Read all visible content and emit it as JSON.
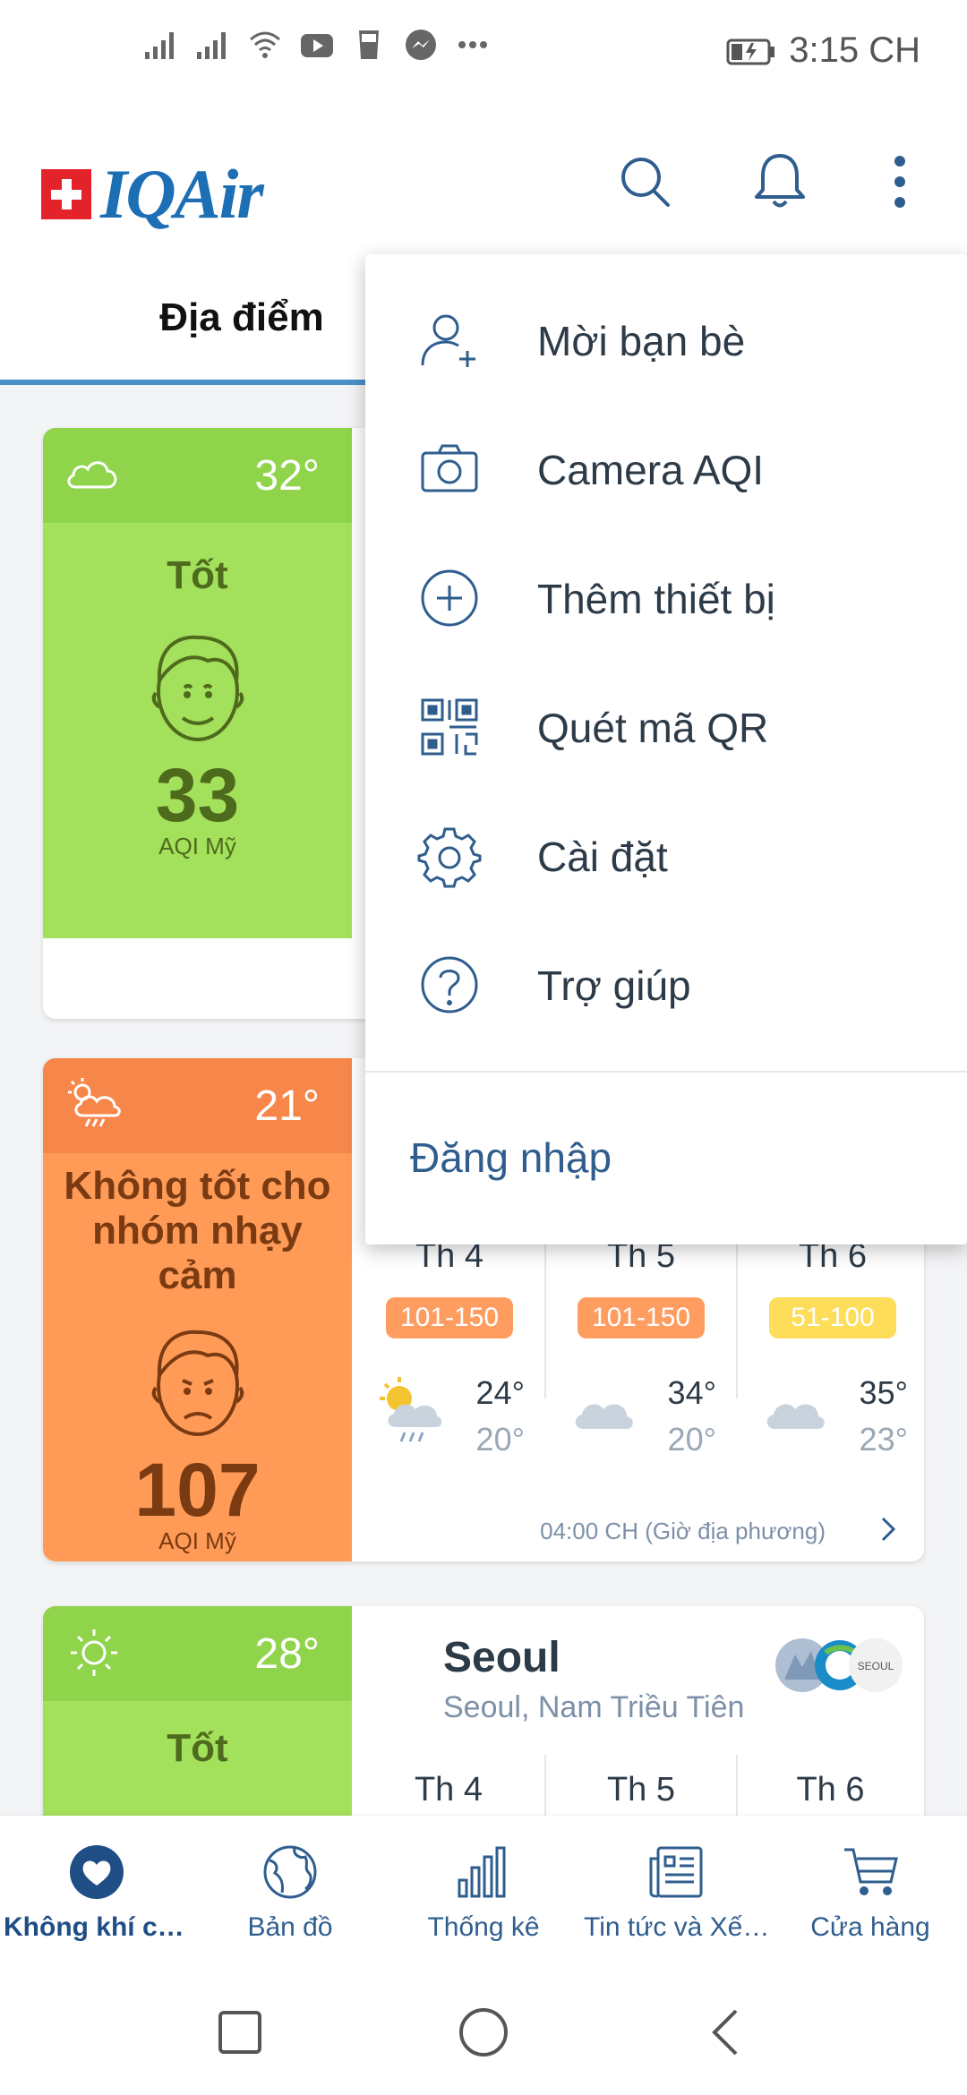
{
  "status_bar": {
    "time": "3:15 CH"
  },
  "header": {
    "logo_text": "IQAir"
  },
  "tabs": {
    "locations": "Địa điểm"
  },
  "colors": {
    "good": "#a3e05b",
    "good_dark": "#8fd44a",
    "unhealthy_sensitive": "#ff9b57",
    "unhealthy_sensitive_dark": "#f6864a",
    "pill_orange": "#ff9d61",
    "pill_yellow": "#fedd5b",
    "accent_blue": "#2f5e8e"
  },
  "cards": [
    {
      "temp": "32°",
      "weather_icon": "cloud-icon",
      "status": "Tốt",
      "aqi": "33",
      "aqi_label": "AQI Mỹ"
    },
    {
      "temp": "21°",
      "weather_icon": "sun-rain-icon",
      "status": "Không tốt cho nhóm nhạy cảm",
      "aqi": "107",
      "aqi_label": "AQI Mỹ",
      "forecast": [
        {
          "day": "Th 4",
          "range": "101-150",
          "high": "24°",
          "low": "20°",
          "icon": "partly-cloudy-rain-icon"
        },
        {
          "day": "Th 5",
          "range": "101-150",
          "high": "34°",
          "low": "20°",
          "icon": "cloud-icon"
        },
        {
          "day": "Th 6",
          "range": "51-100",
          "high": "35°",
          "low": "23°",
          "icon": "cloud-icon"
        }
      ],
      "timestamp": "04:00 CH (Giờ địa phương)"
    },
    {
      "temp": "28°",
      "weather_icon": "sun-icon",
      "status": "Tốt",
      "city": "Seoul",
      "city_sub": "Seoul, Nam Triều Tiên",
      "forecast_days": [
        "Th 4",
        "Th 5",
        "Th 6"
      ]
    }
  ],
  "menu": {
    "items": [
      {
        "label": "Mời bạn bè",
        "icon": "add-user-icon"
      },
      {
        "label": "Camera AQI",
        "icon": "camera-icon"
      },
      {
        "label": "Thêm thiết bị",
        "icon": "plus-circle-icon"
      },
      {
        "label": "Quét mã QR",
        "icon": "qr-code-icon"
      },
      {
        "label": "Cài đặt",
        "icon": "gear-icon"
      },
      {
        "label": "Trợ giúp",
        "icon": "help-icon"
      }
    ],
    "login": "Đăng nhập"
  },
  "bottom_nav": [
    {
      "label": "Không khí của...",
      "icon": "heart-icon"
    },
    {
      "label": "Bản đồ",
      "icon": "globe-icon"
    },
    {
      "label": "Thống kê",
      "icon": "bar-chart-icon"
    },
    {
      "label": "Tin tức và Xếp...",
      "icon": "news-icon"
    },
    {
      "label": "Cửa hàng",
      "icon": "cart-icon"
    }
  ]
}
